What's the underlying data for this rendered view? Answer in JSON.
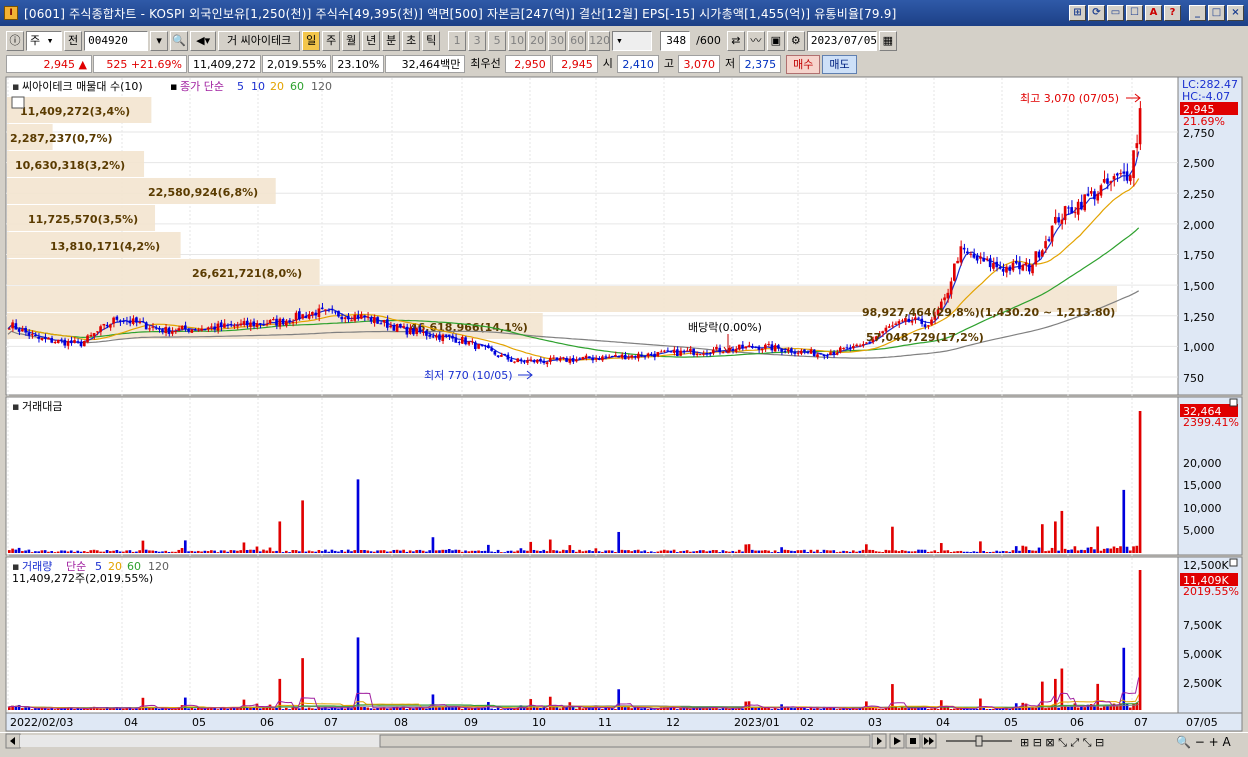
{
  "window": {
    "title": "[0601] 주식종합차트 - KOSPI 외국인보유[1,250(천)] 주식수[49,395(천)] 액면[500] 자본금[247(억)] 결산[12월] EPS[-15] 시가총액[1,455(억)] 유통비율[79.9]",
    "buttons": [
      "⊞",
      "⟳",
      "▭",
      "☐",
      "A",
      "?"
    ],
    "controls": [
      "_",
      "□",
      "×"
    ]
  },
  "toolbar": {
    "period_select": "주",
    "prev_label": "전",
    "code": "004920",
    "stock_name_button": "거 씨아이테크",
    "period_buttons": [
      "일",
      "주",
      "월",
      "년",
      "분",
      "초",
      "틱"
    ],
    "active_period": "일",
    "minute_buttons": [
      "1",
      "3",
      "5",
      "10",
      "20",
      "30",
      "60",
      "120"
    ],
    "count_value": "348",
    "count_max": "/600",
    "date_value": "2023/07/05"
  },
  "quote": {
    "price": "2,945",
    "change": "525",
    "change_pct": "+21.69%",
    "volume": "11,409,272",
    "volume_pct": "2,019.55%",
    "turnover": "23.10%",
    "trade_amount": "32,464백만",
    "best_bid_label": "최우선",
    "best_bid": "2,950",
    "best_ask": "2,945",
    "open_label": "시",
    "open": "2,410",
    "high_label": "고",
    "high": "3,070",
    "low_label": "저",
    "low": "2,375",
    "buy_label": "매수",
    "sell_label": "매도"
  },
  "price_panel": {
    "title": "씨아이테크 매물대 수(10)",
    "ma_label": "종가 단순",
    "ma_periods": [
      "5",
      "10",
      "20",
      "60",
      "120"
    ],
    "lc_label": "LC:282.47",
    "hc_label": "HC:-4.07",
    "current_price_tag": "2,945",
    "current_pct_tag": "21.69%",
    "high_annotation": "최고 3,070 (07/05)",
    "low_annotation": "최저 770 (10/05)",
    "dividend_annotation": "배당락(0.00%)",
    "range_annotation": "98,927,464(29,8%)(1,430.20 ~ 1,213.80)",
    "overlap_annotation": "57,048,729(17,2%)",
    "y_ticks": [
      "2,750",
      "2,500",
      "2,250",
      "2,000",
      "1,750",
      "1,500",
      "1,250",
      "1,000",
      "750"
    ],
    "volume_profile": [
      {
        "label": "11,409,272(3,4%)",
        "pct": 3.4
      },
      {
        "label": "2,287,237(0,7%)",
        "pct": 0.7
      },
      {
        "label": "10,630,318(3,2%)",
        "pct": 3.2
      },
      {
        "label": "22,580,924(6,8%)",
        "pct": 6.8
      },
      {
        "label": "11,725,570(3,5%)",
        "pct": 3.5
      },
      {
        "label": "13,810,171(4,2%)",
        "pct": 4.2
      },
      {
        "label": "26,621,721(8,0%)",
        "pct": 8.0
      },
      {
        "label": "98,927,464(29,8%)",
        "pct": 29.8
      },
      {
        "label": "46,618,966(14,1%)",
        "pct": 14.1
      }
    ]
  },
  "amount_panel": {
    "title": "거래대금",
    "current_tag": "32,464",
    "current_pct_tag": "2399.41%",
    "y_ticks": [
      "20,000",
      "15,000",
      "10,000",
      "5,000"
    ]
  },
  "volume_panel": {
    "title": "거래량",
    "ma_label": "단순",
    "ma_periods": [
      "5",
      "20",
      "60",
      "120"
    ],
    "subtitle": "11,409,272주(2,019.55%)",
    "current_tag": "11,409K",
    "current_pct_tag": "2019.55%",
    "y_ticks": [
      "12,500K",
      "7,500K",
      "5,000K",
      "2,500K"
    ]
  },
  "x_axis": {
    "labels": [
      "2022/02/03",
      "04",
      "05",
      "06",
      "07",
      "08",
      "09",
      "10",
      "11",
      "12",
      "2023/01",
      "02",
      "03",
      "04",
      "05",
      "06",
      "07"
    ],
    "right_label": "07/05"
  },
  "colors": {
    "up": "#e00000",
    "down": "#0000dd",
    "ma5": "#1a2fd0",
    "ma10": "#e3a300",
    "ma20": "#2ea12e",
    "ma60": "#404040",
    "profile": "#f3e4cf",
    "panel_bg": "#ffffff",
    "axis_bg": "#dfe8f5"
  }
}
